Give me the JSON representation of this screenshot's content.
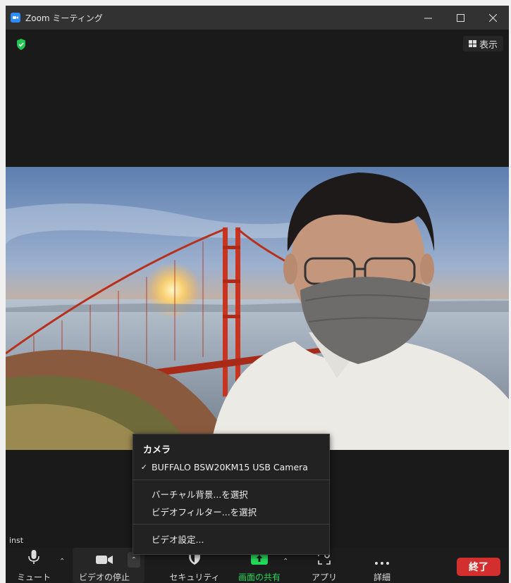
{
  "window": {
    "title": "Zoom ミーティング"
  },
  "view_button": {
    "label": "表示"
  },
  "participant": {
    "name": "inst"
  },
  "camera_menu": {
    "heading": "カメラ",
    "cameras": [
      {
        "label": "BUFFALO BSW20KM15 USB Camera",
        "checked": true
      }
    ],
    "options": [
      "バーチャル背景...を選択",
      "ビデオフィルター...を選択"
    ],
    "settings_label": "ビデオ設定..."
  },
  "toolbar": {
    "mute_label": "ミュート",
    "video_label": "ビデオの停止",
    "security_label": "セキュリティ",
    "share_label": "画面の共有",
    "apps_label": "アプリ",
    "more_label": "詳細",
    "end_label": "終了"
  },
  "colors": {
    "share_accent": "#23d959",
    "end_button": "#d32f2f",
    "shield_green": "#23c552",
    "zoom_blue": "#2d8cff"
  },
  "icons": [
    "zoom-logo-icon",
    "minimize-icon",
    "maximize-icon",
    "close-icon",
    "encryption-shield-icon",
    "view-grid-icon",
    "microphone-icon",
    "video-camera-icon",
    "security-shield-icon",
    "share-screen-icon",
    "apps-icon",
    "more-icon",
    "checkmark-icon",
    "chevron-up-icon"
  ]
}
